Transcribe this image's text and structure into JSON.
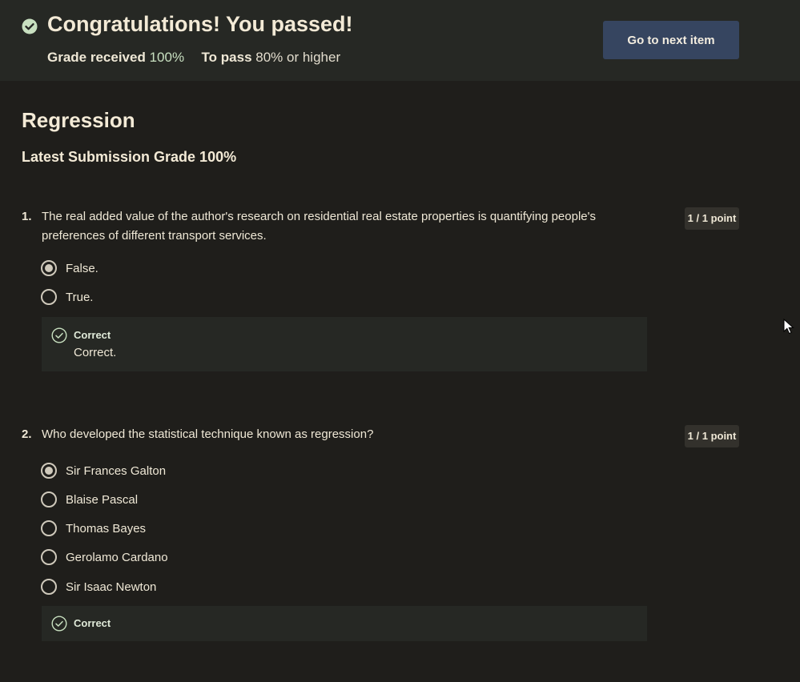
{
  "header": {
    "title": "Congratulations! You passed!",
    "grade_label": "Grade received",
    "grade_value": "100%",
    "pass_label": "To pass",
    "pass_value": "80% or higher",
    "next_button": "Go to next item"
  },
  "quiz": {
    "title": "Regression",
    "submission_grade": "Latest Submission Grade 100%"
  },
  "questions": [
    {
      "number": "1.",
      "text": "The real added value of the author's research on residential real estate properties is quantifying people's preferences of different transport services.",
      "points": "1 / 1 point",
      "options": [
        {
          "label": "False.",
          "checked": true
        },
        {
          "label": "True.",
          "checked": false
        }
      ],
      "feedback": {
        "status": "Correct",
        "text": "Correct."
      }
    },
    {
      "number": "2.",
      "text": "Who developed the statistical technique known as regression?",
      "points": "1 / 1 point",
      "options": [
        {
          "label": "Sir Frances Galton",
          "checked": true
        },
        {
          "label": "Blaise Pascal",
          "checked": false
        },
        {
          "label": "Thomas Bayes",
          "checked": false
        },
        {
          "label": "Gerolamo Cardano",
          "checked": false
        },
        {
          "label": "Sir Isaac Newton",
          "checked": false
        }
      ],
      "feedback": {
        "status": "Correct",
        "text": ""
      }
    }
  ],
  "colors": {
    "background": "#1f1e1b",
    "header_bg": "#262824",
    "button_bg": "#364560",
    "success": "#c8e0c0"
  },
  "icons": {
    "pass": "check-circle-filled-icon",
    "feedback": "check-circle-outline-icon",
    "cursor": "mouse-pointer-icon"
  }
}
